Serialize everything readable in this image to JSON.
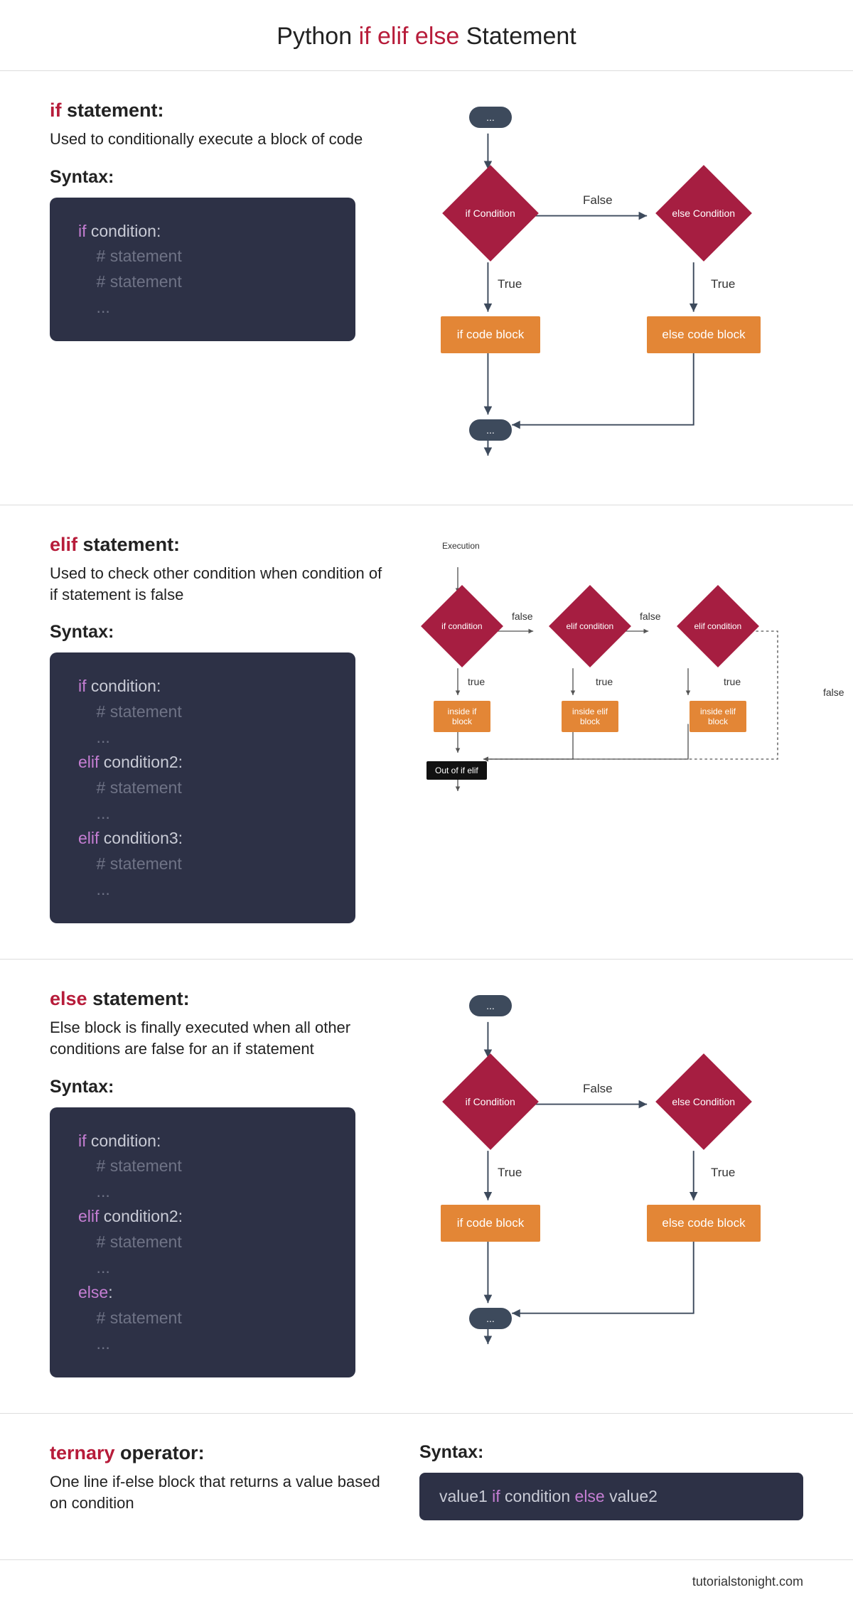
{
  "title": {
    "prefix": "Python ",
    "kw": "if elif else",
    "suffix": " Statement"
  },
  "if": {
    "kw": "if",
    "stmt_suffix": " statement:",
    "desc": "Used to conditionally execute a block of code",
    "syntax_label": "Syntax:",
    "code": {
      "l1_kw": "if",
      "l1_rest": " condition:",
      "l2": "    # statement",
      "l3": "    # statement",
      "l4": "    ..."
    },
    "flow": {
      "start": "...",
      "end": "...",
      "if_cond": "if\nCondition",
      "else_cond": "else\nCondition",
      "false": "False",
      "true": "True",
      "if_block": "if code block",
      "else_block": "else code block"
    }
  },
  "elif": {
    "kw": "elif",
    "stmt_suffix": " statement:",
    "desc": "Used to check other condition when condition of if statement is false",
    "syntax_label": "Syntax:",
    "code": {
      "l1_kw": "if",
      "l1_rest": " condition:",
      "l2": "    # statement",
      "l3": "    ...",
      "l4_kw": "elif",
      "l4_rest": " condition2:",
      "l5": "    # statement",
      "l6": "    ...",
      "l7_kw": "elif",
      "l7_rest": " condition3:",
      "l8": "    # statement",
      "l9": "    ..."
    },
    "flow": {
      "exec": "Execution",
      "if_cond": "if\ncondition",
      "elif_cond": "elif\ncondition",
      "false": "false",
      "true": "true",
      "if_block": "inside if\nblock",
      "elif_block": "inside elif\nblock",
      "out": "Out of if elif"
    }
  },
  "else": {
    "kw": "else",
    "stmt_suffix": " statement:",
    "desc": "Else block is finally executed when all other conditions are false for an if statement",
    "syntax_label": "Syntax:",
    "code": {
      "l1_kw": "if",
      "l1_rest": " condition:",
      "l2": "    # statement",
      "l3": "    ...",
      "l4_kw": "elif",
      "l4_rest": " condition2:",
      "l5": "    # statement",
      "l6": "    ...",
      "l7_kw": "else",
      "l7_rest": ":",
      "l8": "    # statement",
      "l9": "    ..."
    },
    "flow": {
      "start": "...",
      "end": "...",
      "if_cond": "if\nCondition",
      "else_cond": "else\nCondition",
      "false": "False",
      "true": "True",
      "if_block": "if code block",
      "else_block": "else code block"
    }
  },
  "ternary": {
    "kw": "ternary",
    "stmt_suffix": " operator:",
    "desc": "One line if-else block that returns a value based on condition",
    "syntax_label": "Syntax:",
    "code": {
      "v1": "value1 ",
      "if": "if",
      "cond": " condition ",
      "else": "else",
      "v2": " value2"
    }
  },
  "footer": "tutorialstonight.com"
}
